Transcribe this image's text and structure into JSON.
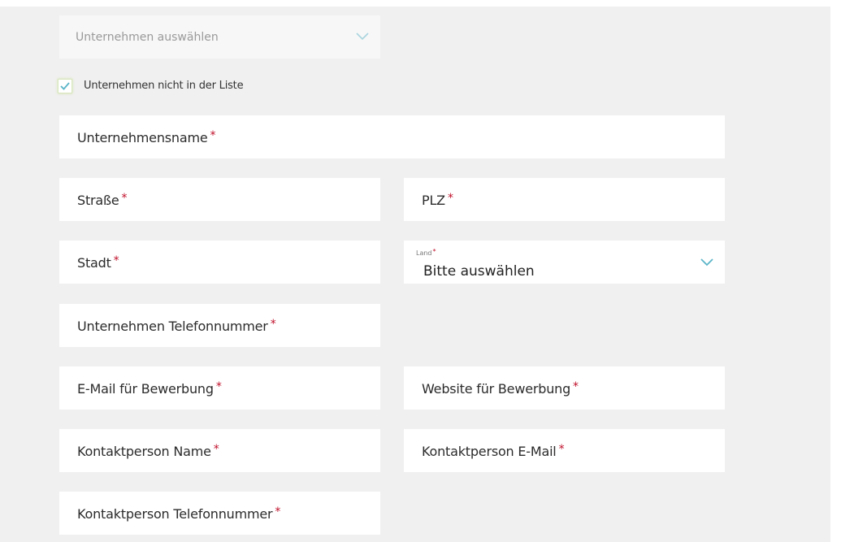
{
  "company_select": {
    "placeholder": "Unternehmen auswählen",
    "icon": "chevron-down-icon"
  },
  "not_in_list": {
    "label": "Unternehmen nicht in der Liste",
    "checked": true
  },
  "required_marker": "*",
  "fields": {
    "company_name": "Unternehmensname",
    "street": "Straße",
    "zip": "PLZ",
    "city": "Stadt",
    "country_label": "Land",
    "country_value": "Bitte auswählen",
    "company_phone": "Unternehmen Telefonnummer",
    "application_email": "E-Mail für Bewerbung",
    "application_website": "Website für Bewerbung",
    "contact_name": "Kontaktperson Name",
    "contact_email": "Kontaktperson E-Mail",
    "contact_phone": "Kontaktperson Telefonnummer"
  },
  "colors": {
    "accent": "#5bb5c8",
    "required": "#c0102a",
    "check": "#5bb5c8"
  }
}
